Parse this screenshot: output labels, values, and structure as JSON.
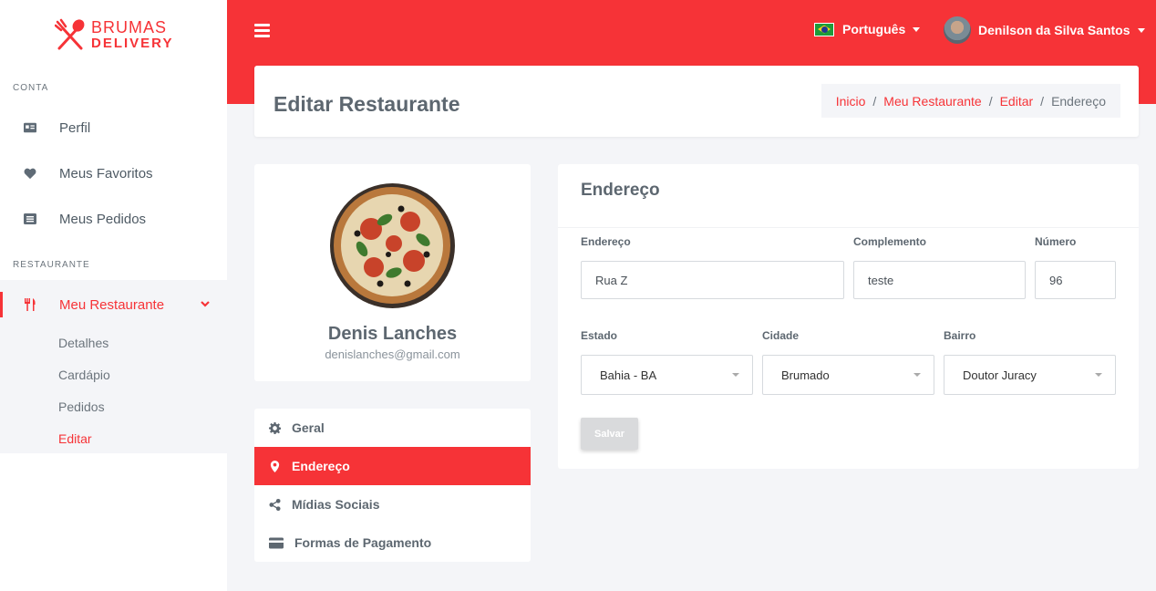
{
  "brand": {
    "line1": "BRUMAS",
    "line2": "DELIVERY",
    "color": "#f63337"
  },
  "sidebar": {
    "section_account": "CONTA",
    "account_items": [
      {
        "label": "Perfil",
        "icon": "id-card-icon"
      },
      {
        "label": "Meus Favoritos",
        "icon": "heart-icon"
      },
      {
        "label": "Meus Pedidos",
        "icon": "list-icon"
      }
    ],
    "section_restaurant": "RESTAURANTE",
    "restaurant_item": {
      "label": "Meu Restaurante",
      "icon": "utensils-icon"
    },
    "sub_items": [
      {
        "label": "Detalhes"
      },
      {
        "label": "Cardápio"
      },
      {
        "label": "Pedidos"
      },
      {
        "label": "Editar"
      }
    ]
  },
  "topbar": {
    "language": "Português",
    "user_name": "Denilson da Silva Santos"
  },
  "header": {
    "title": "Editar Restaurante",
    "breadcrumb": [
      "Inicio",
      "Meu Restaurante",
      "Editar",
      "Endereço"
    ]
  },
  "profile": {
    "name": "Denis Lanches",
    "email": "denislanches@gmail.com"
  },
  "menu": [
    {
      "label": "Geral",
      "icon": "gear-icon"
    },
    {
      "label": "Endereço",
      "icon": "map-marker-icon"
    },
    {
      "label": "Mídias Sociais",
      "icon": "share-icon"
    },
    {
      "label": "Formas de Pagamento",
      "icon": "credit-card-icon"
    }
  ],
  "form": {
    "title": "Endereço",
    "endereco": {
      "label": "Endereço",
      "value": "Rua Z"
    },
    "complemento": {
      "label": "Complemento",
      "value": "teste"
    },
    "numero": {
      "label": "Número",
      "value": "96"
    },
    "estado": {
      "label": "Estado",
      "value": "Bahia - BA"
    },
    "cidade": {
      "label": "Cidade",
      "value": "Brumado"
    },
    "bairro": {
      "label": "Bairro",
      "value": "Doutor Juracy"
    },
    "save_label": "Salvar"
  }
}
